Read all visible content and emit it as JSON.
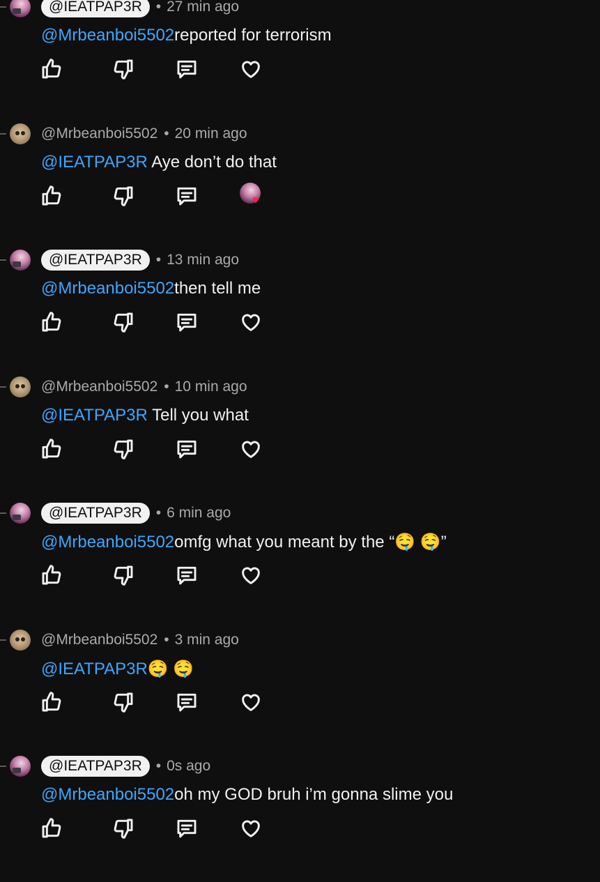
{
  "comments": [
    {
      "author": "@IEATPAP3R",
      "author_style": "chip",
      "time": "27 min ago",
      "mention": "@Mrbeanboi5502",
      "text": "reported for terrorism",
      "heart": "plain"
    },
    {
      "author": "@Mrbeanboi5502",
      "author_style": "plain",
      "time": "20 min ago",
      "mention": "@IEATPAP3R",
      "text": " Aye don’t do that",
      "heart": "creator"
    },
    {
      "author": "@IEATPAP3R",
      "author_style": "chip",
      "time": "13 min ago",
      "mention": "@Mrbeanboi5502",
      "text": "then tell me",
      "heart": "plain"
    },
    {
      "author": "@Mrbeanboi5502",
      "author_style": "plain",
      "time": "10 min ago",
      "mention": "@IEATPAP3R",
      "text": " Tell you what",
      "heart": "plain"
    },
    {
      "author": "@IEATPAP3R",
      "author_style": "chip",
      "time": "6 min ago",
      "mention": "@Mrbeanboi5502",
      "text": "omfg what you meant by the “🤤 🤤”",
      "heart": "plain"
    },
    {
      "author": "@Mrbeanboi5502",
      "author_style": "plain",
      "time": "3 min ago",
      "mention": "@IEATPAP3R",
      "text": "🤤 🤤",
      "heart": "plain"
    },
    {
      "author": "@IEATPAP3R",
      "author_style": "chip",
      "time": "0s ago",
      "mention": "@Mrbeanboi5502",
      "text": "oh my GOD bruh i’m gonna slime you",
      "heart": "plain"
    }
  ],
  "icons": {
    "like": "thumbs-up-icon",
    "dislike": "thumbs-down-icon",
    "reply": "reply-icon",
    "heart": "heart-icon"
  },
  "colors": {
    "background": "#0f0f0f",
    "mention": "#3ea6ff",
    "meta": "#aaaaaa",
    "chip_bg": "#f1f1f1",
    "creator_heart": "#ff2050"
  },
  "separator": "•"
}
